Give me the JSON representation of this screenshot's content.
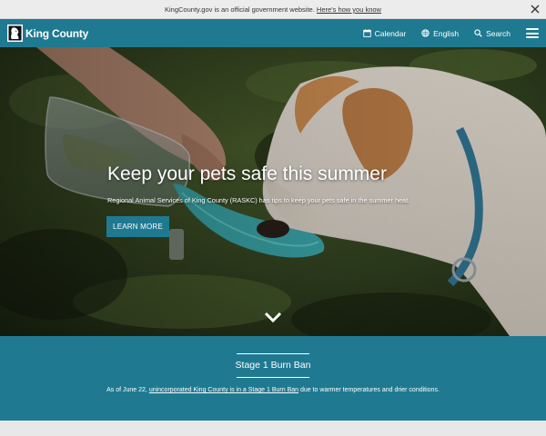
{
  "gov_banner": {
    "text": "KingCounty.gov is an official government website.",
    "link": "Here's how you know",
    "close_icon": "close-icon"
  },
  "header": {
    "logo_text": "King County",
    "logo_icon": "king-county-logo-icon",
    "nav": [
      {
        "label": "Calendar",
        "icon": "calendar-icon"
      },
      {
        "label": "English",
        "icon": "globe-icon"
      },
      {
        "label": "Search",
        "icon": "search-icon"
      }
    ],
    "menu_icon": "hamburger-menu-icon"
  },
  "hero": {
    "title": "Keep your pets safe this summer",
    "subtitle": "Regional Animal Services of King County (RASKC) has tips to keep your pets safe in the summer heat.",
    "button": "LEARN MORE",
    "scroll_icon": "chevron-down-icon"
  },
  "alert": {
    "title": "Stage 1 Burn Ban",
    "text_before": "As of June 22, ",
    "link": "unincorporated King County is in a Stage 1 Burn Ban",
    "text_after": " due to warmer temperatures and drier conditions."
  },
  "colors": {
    "brand_teal": "#1f7a91",
    "banner_gray": "#ececec"
  }
}
